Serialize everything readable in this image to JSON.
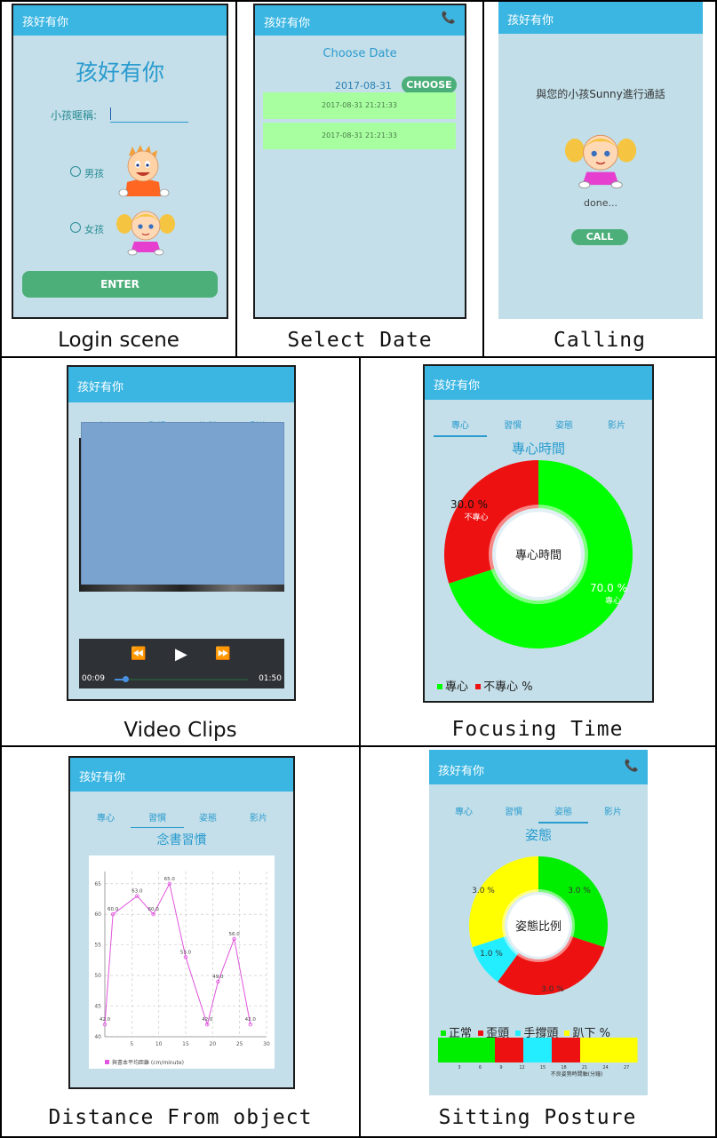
{
  "captions": {
    "login": "Login scene",
    "select_date": "Select Date",
    "calling": "Calling",
    "video": "Video Clips",
    "focus": "Focusing Time",
    "distance": "Distance From object",
    "posture": "Sitting Posture"
  },
  "app_title": "孩好有你",
  "login": {
    "heading": "孩好有你",
    "nickname_label": "小孩暱稱:",
    "nickname_value": "",
    "boy_label": "男孩",
    "girl_label": "女孩",
    "enter_label": "ENTER"
  },
  "select_date": {
    "heading": "Choose Date",
    "date": "2017-08-31",
    "choose_label": "CHOOSE",
    "records": [
      "2017-08-31 21:21:33",
      "2017-08-31 21:21:33"
    ]
  },
  "calling": {
    "message": "與您的小孩Sunny進行通話",
    "status": "done...",
    "call_label": "CALL"
  },
  "video": {
    "tabs": [
      "專心",
      "習慣",
      "姿態",
      "影片"
    ],
    "time_current": "00:09",
    "time_total": "01:50",
    "progress": 0.08
  },
  "tabs": [
    "專心",
    "習慣",
    "姿態",
    "影片"
  ],
  "focus": {
    "title": "專心時間",
    "center_label": "專心時間",
    "legend_focus": "專心",
    "legend_unfocus": "不專心 %",
    "colors": {
      "focus": "#00ff00",
      "unfocus": "#ee1111"
    }
  },
  "distance": {
    "title": "念書習慣",
    "legend": "與書本平均距離  (cm/minute)"
  },
  "posture": {
    "title": "姿態",
    "center_label": "姿態比例",
    "legend": [
      {
        "label": "正常",
        "color": "#00ee00"
      },
      {
        "label": "歪頭",
        "color": "#ee1111"
      },
      {
        "label": "手撐頭",
        "color": "#22eeff"
      },
      {
        "label": "趴下 %",
        "color": "#ffff00"
      }
    ],
    "bar_colors": [
      "#00ee00",
      "#00ee00",
      "#ee1111",
      "#22eeff",
      "#ee1111",
      "#ffff00",
      "#ffff00"
    ],
    "bar_ticks": [
      "3",
      "6",
      "9",
      "12",
      "15",
      "18",
      "21",
      "24",
      "27"
    ],
    "bar_caption": "不良姿勢時間軸(分鐘)"
  },
  "chart_data": [
    {
      "type": "pie",
      "title": "專心時間",
      "labels": [
        "專心",
        "不專心"
      ],
      "values": [
        70.0,
        30.0
      ],
      "value_labels": [
        "70.0 %",
        "30.0 %"
      ],
      "colors": [
        "#00ff00",
        "#ee1111"
      ]
    },
    {
      "type": "line",
      "title": "",
      "x": [
        0,
        3,
        6,
        9,
        12,
        15,
        18,
        21,
        24,
        27,
        30
      ],
      "series": [
        {
          "name": "與書本平均距離  (cm/minute)",
          "values": [
            42.0,
            60.0,
            63.0,
            60.0,
            65.0,
            53.0,
            42.0,
            49.0,
            56.0,
            42.0
          ]
        }
      ],
      "x_points": [
        0,
        1.5,
        6,
        9,
        12,
        15,
        19,
        21,
        24,
        27,
        30
      ],
      "point_labels": [
        "42.0",
        "60.0",
        "63.0",
        "60.0",
        "65.0",
        "53.0",
        "42.0",
        "49.0",
        "56.0",
        "42.0"
      ],
      "xticks": [
        "5",
        "10",
        "15",
        "20",
        "25",
        "30"
      ],
      "yticks": [
        "40",
        "45",
        "50",
        "55",
        "60",
        "65"
      ],
      "xlim": [
        0,
        30
      ],
      "ylim": [
        40,
        67
      ],
      "grid": true,
      "color": "#e055dd"
    },
    {
      "type": "pie",
      "title": "姿態",
      "labels": [
        "正常",
        "歪頭",
        "手撐頭",
        "趴下"
      ],
      "values": [
        3.0,
        3.0,
        1.0,
        3.0
      ],
      "value_labels": [
        "3.0 %",
        "3.0 %",
        "1.0 %",
        "3.0 %"
      ],
      "colors": [
        "#00ee00",
        "#ee1111",
        "#22eeff",
        "#ffff00"
      ]
    }
  ]
}
